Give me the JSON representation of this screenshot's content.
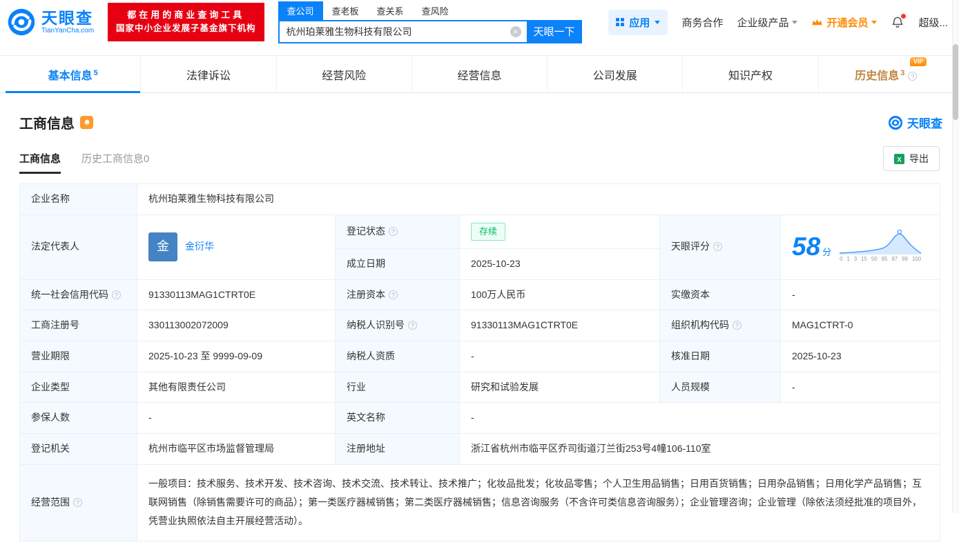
{
  "brand": {
    "name": "天眼查",
    "domain": "TianYanCha.com",
    "promo_line1": "都在用的商业查询工具",
    "promo_line2": "国家中小企业发展子基金旗下机构",
    "accent": "#0b82f8",
    "promo_bg": "#e60012"
  },
  "header": {
    "search_tabs": [
      {
        "label": "查公司"
      },
      {
        "label": "查老板"
      },
      {
        "label": "查关系"
      },
      {
        "label": "查风险"
      }
    ],
    "search_value": "杭州珀莱雅生物科技有限公司",
    "search_button": "天眼一下",
    "app_label": "应用",
    "nav_business": "商务合作",
    "nav_enterprise": "企业级产品",
    "nav_vip": "开通会员",
    "nav_more": "超级..."
  },
  "tabs": [
    {
      "label": "基本信息",
      "badge": "5"
    },
    {
      "label": "法律诉讼"
    },
    {
      "label": "经营风险"
    },
    {
      "label": "经营信息"
    },
    {
      "label": "公司发展"
    },
    {
      "label": "知识产权"
    },
    {
      "label": "历史信息",
      "badge": "3",
      "vip": "VIP"
    }
  ],
  "section": {
    "title": "工商信息",
    "logo_text": "天眼查",
    "subtabs": [
      {
        "label": "工商信息"
      },
      {
        "label": "历史工商信息0"
      }
    ],
    "export_label": "导出"
  },
  "table": {
    "company_name": {
      "label": "企业名称",
      "value": "杭州珀莱雅生物科技有限公司"
    },
    "legal_rep": {
      "label": "法定代表人",
      "avatar": "金",
      "name": "金衍华"
    },
    "reg_status": {
      "label": "登记状态",
      "value": "存续"
    },
    "establish_date": {
      "label": "成立日期",
      "value": "2025-10-23"
    },
    "score": {
      "label": "天眼评分",
      "value": "58",
      "unit": "分",
      "axis": [
        "0",
        "1",
        "3",
        "15",
        "50",
        "85",
        "97",
        "99",
        "100"
      ]
    },
    "credit_code": {
      "label": "统一社会信用代码",
      "value": "91330113MAG1CTRT0E"
    },
    "reg_capital": {
      "label": "注册资本",
      "value": "100万人民币"
    },
    "paid_capital": {
      "label": "实缴资本",
      "value": "-"
    },
    "reg_number": {
      "label": "工商注册号",
      "value": "330113002072009"
    },
    "taxpayer_id": {
      "label": "纳税人识别号",
      "value": "91330113MAG1CTRT0E"
    },
    "org_code": {
      "label": "组织机构代码",
      "value": "MAG1CTRT-0"
    },
    "business_term": {
      "label": "营业期限",
      "value": "2025-10-23 至 9999-09-09"
    },
    "taxpayer_quality": {
      "label": "纳税人资质",
      "value": "-"
    },
    "approval_date": {
      "label": "核准日期",
      "value": "2025-10-23"
    },
    "company_type": {
      "label": "企业类型",
      "value": "其他有限责任公司"
    },
    "industry": {
      "label": "行业",
      "value": "研究和试验发展"
    },
    "staff_size": {
      "label": "人员规模",
      "value": "-"
    },
    "insured_count": {
      "label": "参保人数",
      "value": "-"
    },
    "english_name": {
      "label": "英文名称",
      "value": "-"
    },
    "reg_authority": {
      "label": "登记机关",
      "value": "杭州市临平区市场监督管理局"
    },
    "reg_address": {
      "label": "注册地址",
      "value": "浙江省杭州市临平区乔司街道汀兰街253号4幢106-110室"
    },
    "business_scope": {
      "label": "经营范围",
      "value": "一般项目：技术服务、技术开发、技术咨询、技术交流、技术转让、技术推广；化妆品批发；化妆品零售；个人卫生用品销售；日用百货销售；日用杂品销售；日用化学产品销售；互联网销售（除销售需要许可的商品）；第一类医疗器械销售；第二类医疗器械销售；信息咨询服务（不含许可类信息咨询服务）；企业管理咨询；企业管理（除依法须经批准的项目外，凭营业执照依法自主开展经营活动）。"
    }
  }
}
